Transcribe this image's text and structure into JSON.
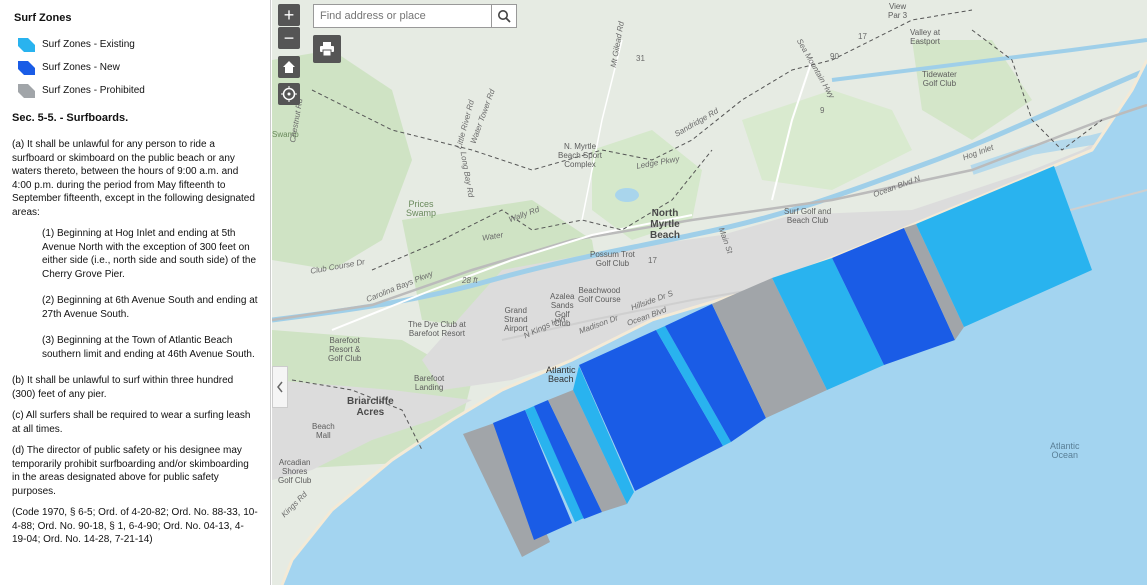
{
  "legend": {
    "title": "Surf Zones",
    "items": [
      {
        "label": "Surf Zones - Existing",
        "color": "#29b3ef"
      },
      {
        "label": "Surf Zones - New",
        "color": "#1a5ce6"
      },
      {
        "label": "Surf Zones - Prohibited",
        "color": "#a1a5a9"
      }
    ]
  },
  "ordinance": {
    "title": "Sec. 5-5. - Surfboards.",
    "paragraphs": [
      "(a) It shall be unlawful for any person to ride a surfboard or skimboard on the public beach or any waters thereto, between the hours of 9:00 a.m. and 4:00 p.m. during the period from May fifteenth to September fifteenth, except in the following designated areas:",
      "(1) Beginning at Hog Inlet and ending at 5th Avenue North with the exception of 300 feet on either side (i.e., north side and south side) of the Cherry Grove Pier.",
      "(2) Beginning at 6th Avenue South and ending at 27th Avenue South.",
      "(3) Beginning at the Town of Atlantic Beach southern limit and ending at 46th Avenue South.",
      "(b) It shall be unlawful to surf within three hundred (300) feet of any pier.",
      "(c) All surfers shall be required to wear a surfing leash at all times.",
      "(d) The director of public safety or his designee may temporarily prohibit surfboarding and/or skimboarding in the areas designated above for public safety purposes.",
      "(Code 1970, § 6-5; Ord. of 4-20-82; Ord. No. 88-33, 10-4-88; Ord. No. 90-18, § 1, 6-4-90; Ord. No. 04-13, 4-19-04; Ord. No. 14-28, 7-21-14)"
    ]
  },
  "map": {
    "search_placeholder": "Find address or place",
    "zoom_in": "+",
    "zoom_out": "−",
    "labels": {
      "north_myrtle": "North\nMyrtle\nBeach",
      "atlantic_ocean": "Atlantic\nOcean",
      "briarcliffe": "Briarcliffe\nAcres",
      "atlantic_beach": "Atlantic\nBeach",
      "possum_trot": "Possum Trot\nGolf Club",
      "beachwood": "Beachwood\nGolf Course",
      "surf_golf": "Surf Golf and\nBeach Club",
      "tidewater": "Tidewater\nGolf Club",
      "valley": "Valley at\nEastport",
      "view": "View\nPar 3",
      "sports": "N. Myrtle\nBeach Sport\nComplex",
      "prices_swamp": "Prices\nSwamp",
      "dye_club": "The Dye Club at\nBarefoot Resort",
      "barefoot_resort": "Barefoot\nResort &\nGolf Club",
      "barefoot_landing": "Barefoot\nLanding",
      "grand_strand": "Grand\nStrand\nAirport",
      "azalea": "Azalea\nSands\nGolf\nClub",
      "beach_mall": "Beach\nMall",
      "arcadian": "Arcadian\nShores\nGolf Club",
      "swamp": "Swamp"
    },
    "roads": {
      "club_course": "Club Course Dr",
      "carolina_bays": "Carolina Bays Pkwy",
      "little_river": "Little River Rd",
      "sandridge": "Sandridge Rd",
      "sea_mountain": "Sea Mountain Hwy",
      "kings_hwy": "N Kings Hwy",
      "ocean_blvd": "Ocean Blvd",
      "ocean_blvd2": "Ocean Blvd N",
      "madison": "Madison Dr",
      "hillside": "Hillside Dr S",
      "hog_inlet": "Hog Inlet",
      "long_bay": "Long Bay Rd",
      "water_tower": "Water Tower Rd",
      "mt_gilead": "Mt Gilead Rd",
      "chestnut": "Chestnut Rd",
      "ledge": "Ledge Pkwy",
      "rt31": "31",
      "rt90": "90",
      "rt17": "17",
      "rt9": "9",
      "rt17b": "17",
      "kings_rd": "Kings Rd",
      "main_st": "Main St",
      "wally": "Wally Rd",
      "water": "Water",
      "twenty_eight": "28 ft"
    }
  }
}
